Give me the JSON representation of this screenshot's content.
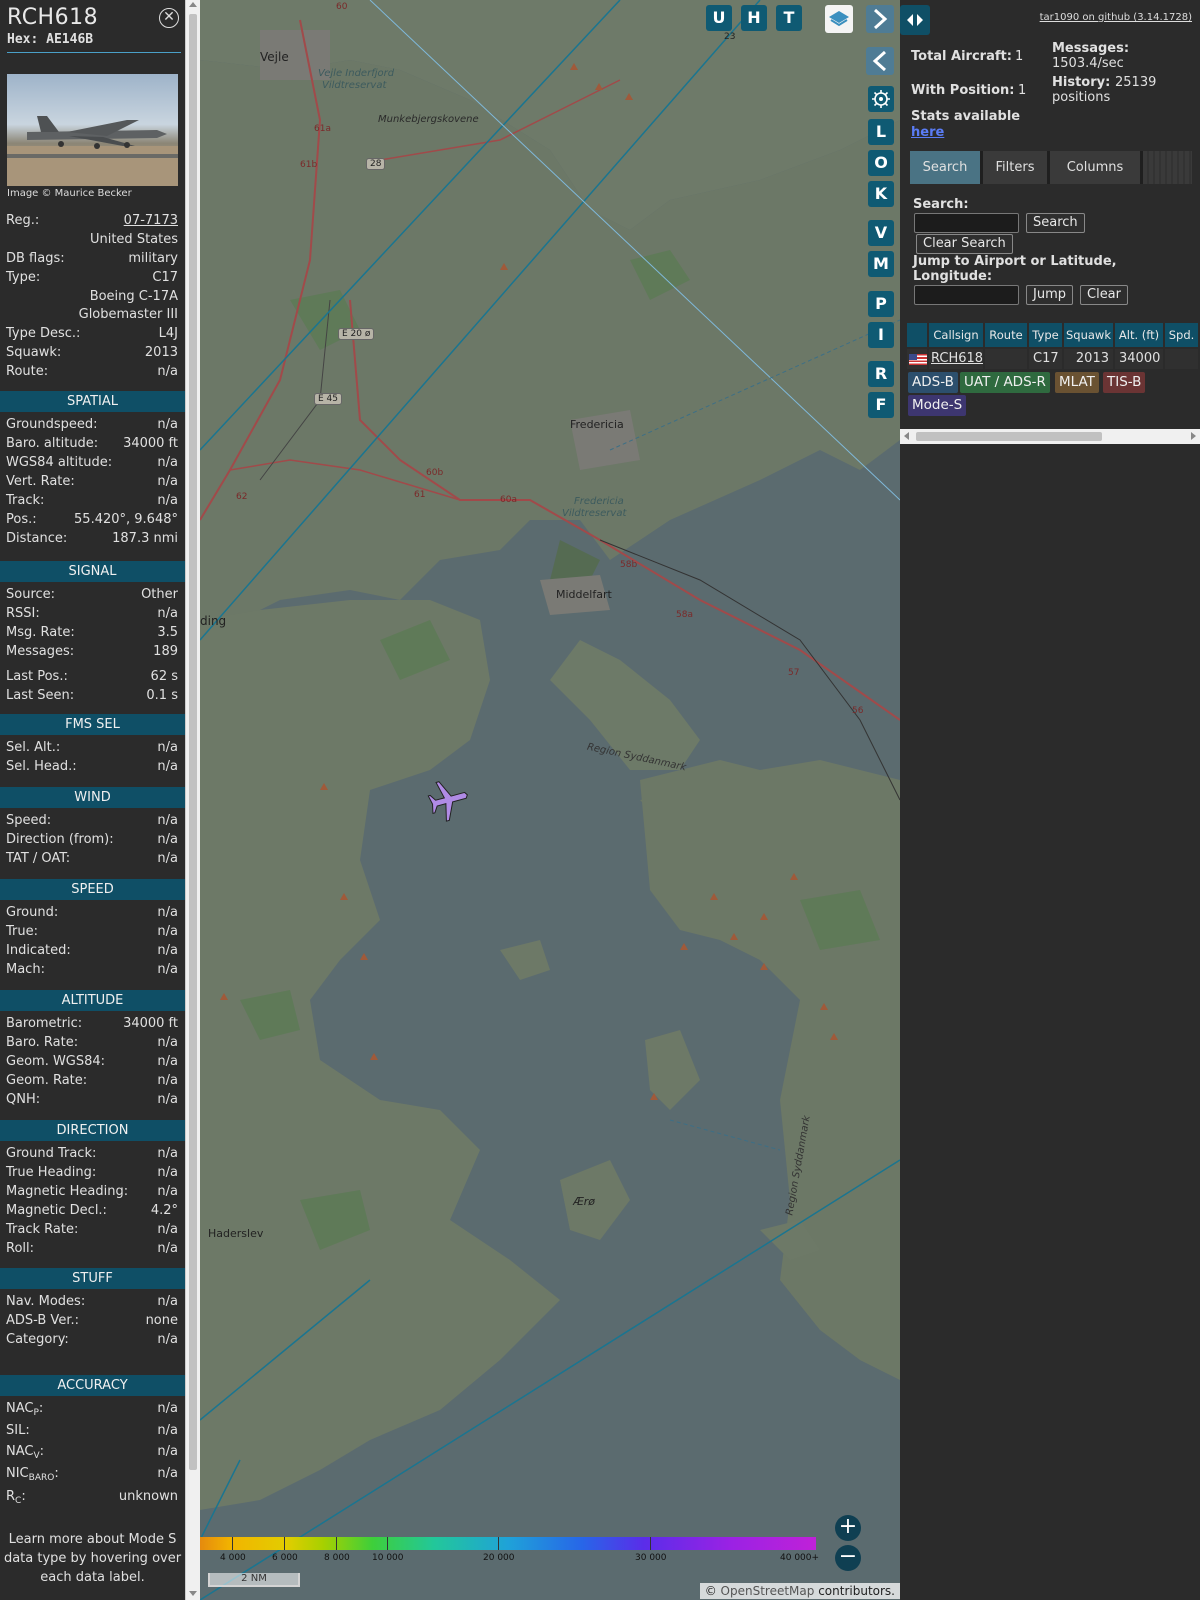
{
  "aircraft": {
    "callsign": "RCH618",
    "hex_label": "Hex:",
    "hex": "AE146B",
    "image_credit": "Image © Maurice Becker"
  },
  "details": [
    {
      "label": "Reg.:",
      "value": "07-7173",
      "link": true
    },
    {
      "label": "",
      "value": "United States"
    },
    {
      "label": "DB flags:",
      "value": "military"
    },
    {
      "label": "Type:",
      "value": "C17"
    },
    {
      "label": "",
      "value": "Boeing C-17A"
    },
    {
      "label": "",
      "value": "Globemaster III"
    },
    {
      "label": "Type Desc.:",
      "value": "L4J"
    },
    {
      "label": "Squawk:",
      "value": "2013"
    },
    {
      "label": "Route:",
      "value": "n/a"
    }
  ],
  "sections": {
    "spatial": {
      "title": "SPATIAL",
      "rows": [
        {
          "label": "Groundspeed:",
          "value": "n/a"
        },
        {
          "label": "Baro. altitude:",
          "value": "34000 ft"
        },
        {
          "label": "WGS84 altitude:",
          "value": "n/a"
        },
        {
          "label": "Vert. Rate:",
          "value": "n/a"
        },
        {
          "label": "Track:",
          "value": "n/a"
        },
        {
          "label": "Pos.:",
          "value": "55.420°, 9.648°"
        },
        {
          "label": "Distance:",
          "value": "187.3 nmi"
        }
      ]
    },
    "signal": {
      "title": "SIGNAL",
      "rows": [
        {
          "label": "Source:",
          "value": "Other"
        },
        {
          "label": "RSSI:",
          "value": "n/a"
        },
        {
          "label": "Msg. Rate:",
          "value": "3.5"
        },
        {
          "label": "Messages:",
          "value": "189"
        },
        {
          "label": "Last Pos.:",
          "value": "62 s"
        },
        {
          "label": "Last Seen:",
          "value": "0.1 s"
        }
      ]
    },
    "fms": {
      "title": "FMS SEL",
      "rows": [
        {
          "label": "Sel. Alt.:",
          "value": "n/a"
        },
        {
          "label": "Sel. Head.:",
          "value": "n/a"
        }
      ]
    },
    "wind": {
      "title": "WIND",
      "rows": [
        {
          "label": "Speed:",
          "value": "n/a"
        },
        {
          "label": "Direction (from):",
          "value": "n/a"
        },
        {
          "label": "TAT / OAT:",
          "value": "n/a"
        }
      ]
    },
    "speed": {
      "title": "SPEED",
      "rows": [
        {
          "label": "Ground:",
          "value": "n/a"
        },
        {
          "label": "True:",
          "value": "n/a"
        },
        {
          "label": "Indicated:",
          "value": "n/a"
        },
        {
          "label": "Mach:",
          "value": "n/a"
        }
      ]
    },
    "altitude": {
      "title": "ALTITUDE",
      "rows": [
        {
          "label": "Barometric:",
          "value": "34000 ft"
        },
        {
          "label": "Baro. Rate:",
          "value": "n/a"
        },
        {
          "label": "Geom. WGS84:",
          "value": "n/a"
        },
        {
          "label": "Geom. Rate:",
          "value": "n/a"
        },
        {
          "label": "QNH:",
          "value": "n/a"
        }
      ]
    },
    "direction": {
      "title": "DIRECTION",
      "rows": [
        {
          "label": "Ground Track:",
          "value": "n/a"
        },
        {
          "label": "True Heading:",
          "value": "n/a"
        },
        {
          "label": "Magnetic Heading:",
          "value": "n/a"
        },
        {
          "label": "Magnetic Decl.:",
          "value": "4.2°"
        },
        {
          "label": "Track Rate:",
          "value": "n/a"
        },
        {
          "label": "Roll:",
          "value": "n/a"
        }
      ]
    },
    "stuff": {
      "title": "STUFF",
      "rows": [
        {
          "label": "Nav. Modes:",
          "value": "n/a"
        },
        {
          "label": "ADS-B Ver.:",
          "value": "none"
        },
        {
          "label": "Category:",
          "value": "n/a"
        }
      ]
    },
    "accuracy": {
      "title": "ACCURACY",
      "rows": [
        {
          "label": "NAC",
          "sub": "P",
          "value": "n/a"
        },
        {
          "label": "SIL:",
          "sub": "",
          "value": "n/a"
        },
        {
          "label": "NAC",
          "sub": "V",
          "value": "n/a"
        },
        {
          "label": "NIC",
          "sub": "BARO",
          "value": "n/a"
        },
        {
          "label": "R",
          "sub": "C",
          "value": "unknown"
        }
      ]
    }
  },
  "footer_note": "Learn more about Mode S data type by hovering over each data label.",
  "map": {
    "labels": {
      "vejle": "Vejle",
      "vejle_fjord": "Vejle Inderfjord",
      "vildtreservat1": "Vildtreservat",
      "munkebjerg": "Munkebjergskovene",
      "fredericia": "Fredericia",
      "fredericia_res": "Fredericia",
      "vildtreservat2": "Vildtreservat",
      "middelfart": "Middelfart",
      "region_syd": "Region Syddanmark",
      "region_syd2": "Region Syddanmark",
      "haderslev": "Haderslev",
      "aro": "Ærø",
      "ding": "ding"
    },
    "roads": [
      "E 20 ø",
      "E 45",
      "28",
      "23",
      "62",
      "61",
      "61a",
      "61b",
      "60",
      "60a",
      "60b",
      "58a",
      "58b",
      "57",
      "56"
    ],
    "buttons": {
      "u": "U",
      "h": "H",
      "t": "T",
      "l": "L",
      "o": "O",
      "k": "K",
      "v": "V",
      "m": "M",
      "p": "P",
      "i": "I",
      "r": "R",
      "f": "F"
    },
    "zoom_in": "+",
    "zoom_out": "−",
    "altitude_scale": [
      "4 000",
      "6 000",
      "8 000",
      "10 000",
      "20 000",
      "30 000",
      "40 000+"
    ],
    "scale_bar": "2 NM",
    "attribution_prefix": "©",
    "attribution_osm": "OpenStreetMap",
    "attribution_suffix": "contributors."
  },
  "sidebar": {
    "github_link": "tar1090 on github (3.14.1728)",
    "total_aircraft_label": "Total Aircraft:",
    "total_aircraft": "1",
    "with_position_label": "With Position:",
    "with_position": "1",
    "messages_label": "Messages:",
    "messages_rate": "1503.4/sec",
    "history_label": "History:",
    "history_value": "25139",
    "history_unit": "positions",
    "stats_label": "Stats available",
    "stats_link": "here",
    "tabs": [
      "Search",
      "Filters",
      "Columns"
    ],
    "search_label": "Search:",
    "search_button": "Search",
    "clear_search_button": "Clear Search",
    "jump_label": "Jump to Airport or Latitude, Longitude:",
    "jump_button": "Jump",
    "clear_button": "Clear",
    "table": {
      "headers": [
        "Callsign",
        "Route",
        "Type",
        "Squawk",
        "Alt. (ft)",
        "Spd."
      ],
      "rows": [
        {
          "callsign": "RCH618",
          "route": "",
          "type": "C17",
          "squawk": "2013",
          "alt": "34000",
          "spd": ""
        }
      ]
    },
    "legend": [
      {
        "label": "ADS-B",
        "color": "#2c4f6d"
      },
      {
        "label": "UAT / ADS-R",
        "color": "#2f6a3f"
      },
      {
        "label": "MLAT",
        "color": "#6a5232"
      },
      {
        "label": "TIS-B",
        "color": "#6b3434"
      },
      {
        "label": "Mode-S",
        "color": "#3d3670"
      }
    ]
  },
  "colors": {
    "section_header": "#0f4f66",
    "accent": "#4aa0c8",
    "aircraft_icon": "#b08be6",
    "map_water": "#5b6b6f",
    "map_land": "#6d7a68"
  },
  "icons": [
    "close-icon",
    "aircraft-icon",
    "layers-icon",
    "gear-icon",
    "chevron-right-icon",
    "chevron-left-icon",
    "expand-icon"
  ]
}
